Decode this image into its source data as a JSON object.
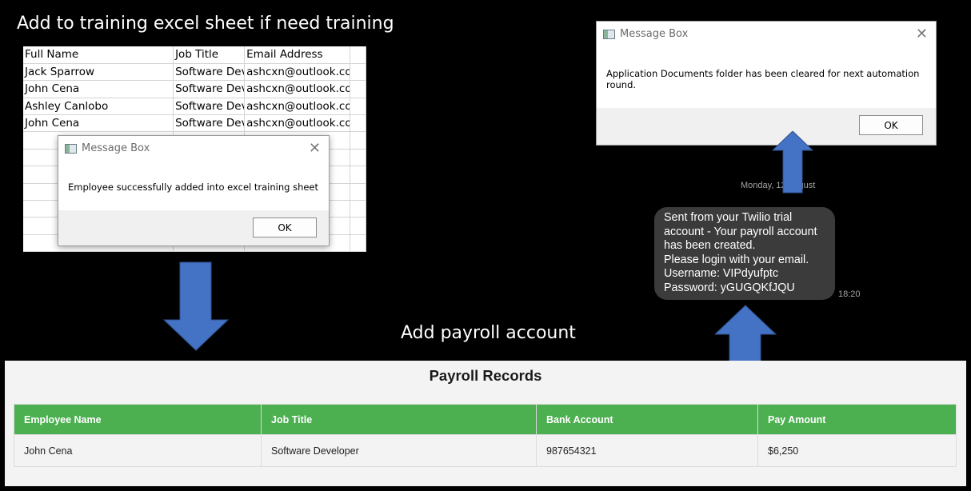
{
  "captions": {
    "training": "Add to training excel sheet if need training",
    "payroll": "Add payroll account"
  },
  "spreadsheet": {
    "headers": [
      "Full Name",
      "Job Title",
      "Email Address"
    ],
    "rows": [
      [
        "Jack Sparrow",
        "Software Developer",
        "ashcxn@outlook.com"
      ],
      [
        "John Cena",
        "Software Developer",
        "ashcxn@outlook.com"
      ],
      [
        "Ashley Canlobo",
        "Software Developer",
        "ashcxn@outlook.com"
      ],
      [
        "John Cena",
        "Software Developer",
        "ashcxn@outlook.com"
      ]
    ]
  },
  "training_msgbox": {
    "title": "Message Box",
    "message": "Employee successfully added into excel training sheet",
    "ok_label": "OK",
    "close_glyph": "✕"
  },
  "cleanup_msgbox": {
    "title": "Message Box",
    "message": "Application Documents folder has been cleared for next automation round.",
    "ok_label": "OK",
    "close_glyph": "✕"
  },
  "sms": {
    "day_label": "Monday, 12 August",
    "lines": [
      "Sent from your Twilio trial",
      "account - Your payroll account",
      "has been created.",
      "Please login with your email.",
      "Username: VIPdyufptc",
      "Password: yGUGQKfJQU"
    ],
    "time": "18:20"
  },
  "payroll": {
    "title": "Payroll Records",
    "columns": [
      "Employee Name",
      "Job Title",
      "Bank Account",
      "Pay Amount"
    ],
    "rows": [
      [
        "John Cena",
        "Software Developer",
        "987654321",
        "$6,250"
      ]
    ]
  },
  "colors": {
    "arrow_fill": "#4472c4",
    "table_header": "#4caf50"
  },
  "icons": {
    "msgbox_app": "window-icon",
    "close": "close-icon",
    "arrows": "block-arrow-icon"
  }
}
